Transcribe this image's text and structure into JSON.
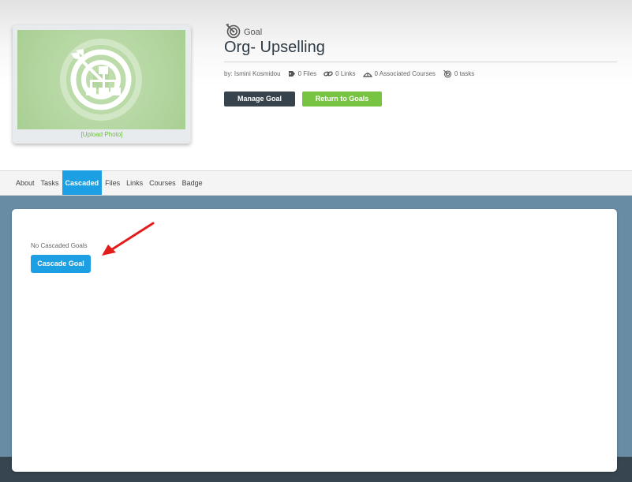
{
  "goal": {
    "type_label": "Goal",
    "title": "Org- Upselling",
    "upload_label": "[Upload Photo]",
    "meta": {
      "author": "by: Ismini Kosmidou",
      "files": "0 Files",
      "links": "0 Links",
      "courses": "0 Associated Courses",
      "tasks": "0 tasks"
    },
    "buttons": {
      "manage": "Manage Goal",
      "return": "Return to Goals"
    }
  },
  "tabs": [
    {
      "label": "About",
      "active": false
    },
    {
      "label": "Tasks",
      "active": false
    },
    {
      "label": "Cascaded",
      "active": true
    },
    {
      "label": "Files",
      "active": false
    },
    {
      "label": "Links",
      "active": false
    },
    {
      "label": "Courses",
      "active": false
    },
    {
      "label": "Badge",
      "active": false
    }
  ],
  "cascaded": {
    "empty_text": "No Cascaded Goals",
    "cascade_button": "Cascade Goal"
  },
  "colors": {
    "accent": "#1d9fe3",
    "success": "#76c442",
    "dark": "#36434c",
    "arrow": "#e41b1b"
  },
  "icons": {
    "goal": "target-icon",
    "files": "tag-icon",
    "links": "link-icon",
    "courses": "courses-icon",
    "tasks": "tasks-target-icon",
    "photo": "goal-hierarchy-icon"
  }
}
